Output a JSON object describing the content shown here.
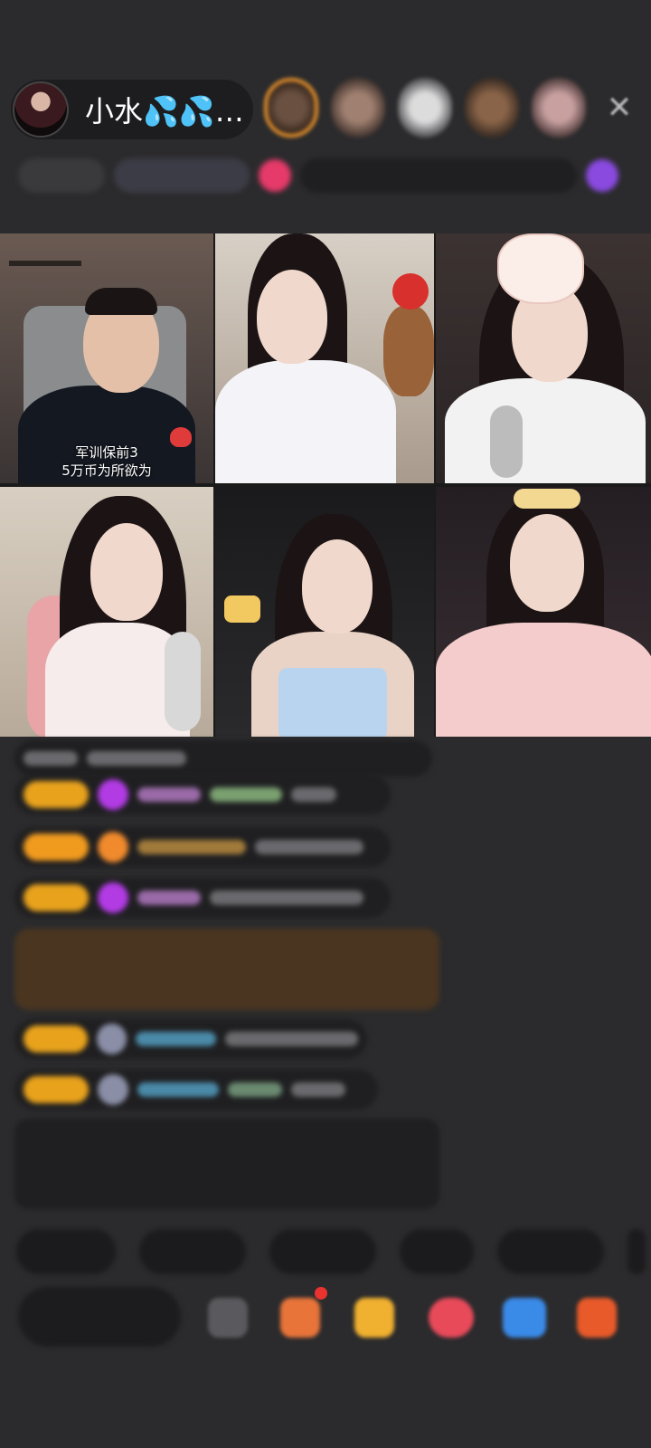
{
  "header": {
    "host_name": "小水💦💦…",
    "close_icon": "close-icon"
  },
  "video_grid": {
    "tiles": [
      {
        "caption_line1": "军训保前3",
        "caption_line2": "5万币为所欲为"
      },
      {},
      {},
      {},
      {},
      {}
    ]
  },
  "colors": {
    "background": "#2b2b2d",
    "accent_orange": "#e4902b",
    "badge_yellow": "#e8a21c",
    "gem_purple": "#b23be4"
  }
}
